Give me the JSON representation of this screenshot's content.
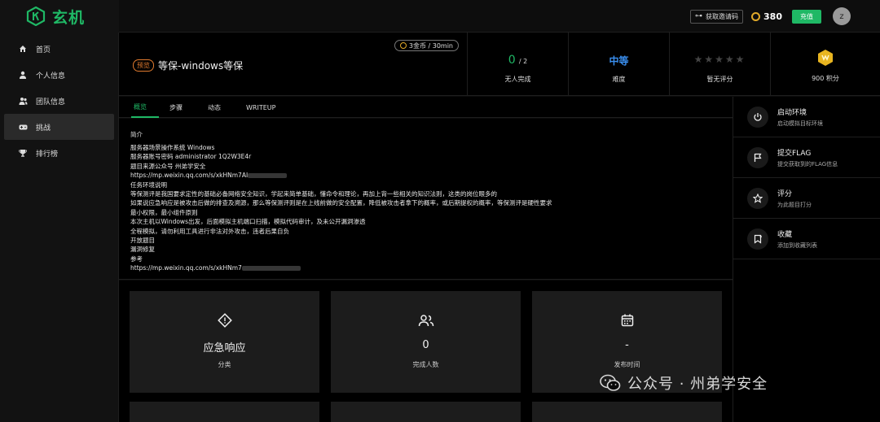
{
  "brand": {
    "name": "玄机"
  },
  "topbar": {
    "invite_label": "获取邀请码",
    "coins": "380",
    "recharge_label": "充值",
    "avatar_initial": "z"
  },
  "sidebar": {
    "items": [
      {
        "label": "首页",
        "icon": "home-icon"
      },
      {
        "label": "个人信息",
        "icon": "user-icon"
      },
      {
        "label": "团队信息",
        "icon": "team-icon"
      },
      {
        "label": "挑战",
        "icon": "gamepad-icon",
        "active": true
      },
      {
        "label": "排行榜",
        "icon": "trophy-icon"
      }
    ]
  },
  "challenge": {
    "cost": "3金币 / 30min",
    "tag": "预览",
    "title": "等保-windows等保",
    "solved": "0",
    "solved_total": "/ 2",
    "solved_label": "无人完成",
    "difficulty": "中等",
    "difficulty_label": "难度",
    "rating_label": "暂无评分",
    "points_label": "900 积分",
    "rating_stars": 0
  },
  "tabs": [
    "概览",
    "步骤",
    "动态",
    "WRITEUP"
  ],
  "description": {
    "heading": "简介",
    "lines": [
      "服务器场景操作系统 Windows",
      "服务器账号密码 administrator 1Q2W3E4r",
      "题目来源公众号  州弟学安全",
      "https://mp.weixin.qq.com/s/xkHNm7AI",
      "任务环境说明",
      "    等保测评是我国要求定性的基础必备网络安全知识，学起来简单基础，懂命令和理论，再加上背一些相关的知识法则，这类的岗位眼多的",
      "如果说应急响应是被攻击后做的排查及溯源，那么等保测评则是在上线前做的安全配置，降低被攻击者拿下的概率，或后期提权的概率，等保测评是硬性要求",
      "最小权限，最小组件原则",
      "本次主机以Windows出发，后面模拟主机端口扫描，模拟代码审计，及未公开漏洞渗透",
      "全程模拟，请勿利用工具进行非法对外攻击，违者后果自负",
      "开放题目",
      "    漏洞修复",
      "参考",
      "https://mp.weixin.qq.com/s/xkHNm7"
    ]
  },
  "info_cards": [
    {
      "icon": "alert-diamond-icon",
      "value": "应急响应",
      "label": "分类"
    },
    {
      "icon": "users-icon",
      "value": "0",
      "label": "完成人数"
    },
    {
      "icon": "calendar-icon",
      "value": "-",
      "label": "发布时间"
    }
  ],
  "actions": [
    {
      "icon": "power-icon",
      "title": "启动环境",
      "subtitle": "启动模拟目标环境"
    },
    {
      "icon": "flag-icon",
      "title": "提交FLAG",
      "subtitle": "提交获取到的FLAG信息"
    },
    {
      "icon": "star-icon",
      "title": "评分",
      "subtitle": "为此题目打分"
    },
    {
      "icon": "bookmark-icon",
      "title": "收藏",
      "subtitle": "添加到收藏列表"
    }
  ],
  "watermark": {
    "text": "公众号 · 州弟学安全"
  },
  "colors": {
    "accent": "#1fb865",
    "difficulty": "#3a8ff0",
    "preview_tag": "#e07a2e",
    "coin": "#e0a92a"
  }
}
